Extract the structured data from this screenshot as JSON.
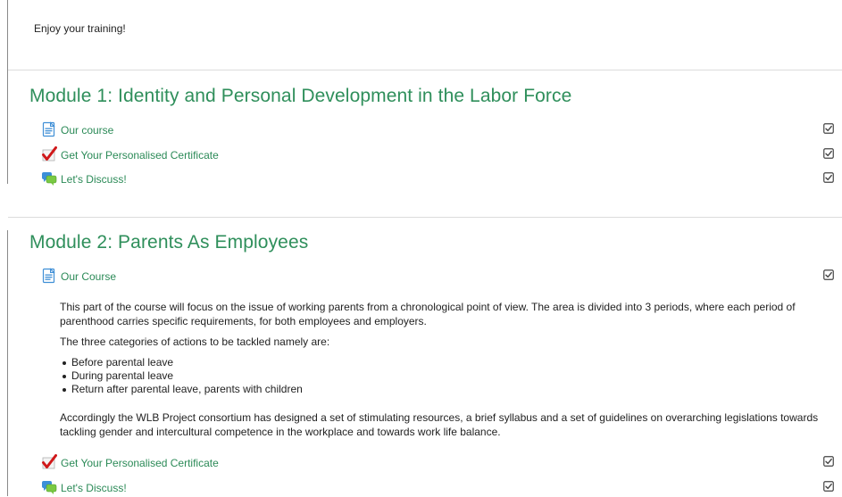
{
  "intro_text": "Enjoy your training!",
  "sections": [
    {
      "title": "Module 1: Identity and Personal Development in the Labor Force",
      "activities": [
        {
          "label": "Our course",
          "icon": "page-icon",
          "completed": true
        },
        {
          "label": "Get Your Personalised Certificate",
          "icon": "certificate-icon",
          "completed": true
        },
        {
          "label": "Let's Discuss!",
          "icon": "forum-icon",
          "completed": true
        }
      ]
    },
    {
      "title": "Module 2: Parents As Employees",
      "activities": [
        {
          "label": "Our Course",
          "icon": "page-icon",
          "completed": true
        },
        {
          "label": "Get Your Personalised Certificate",
          "icon": "certificate-icon",
          "completed": true
        },
        {
          "label": "Let's Discuss!",
          "icon": "forum-icon",
          "completed": true
        }
      ],
      "description": {
        "paragraph1": "This part of the course will focus on the issue of working parents from a chronological point of view. The area is divided into 3 periods, where each period of parenthood carries specific requirements, for both employees and employers.",
        "paragraph2": "The three categories of actions to be tackled namely are:",
        "bullets": [
          "Before parental leave",
          "During parental leave",
          "Return after parental leave, parents with children"
        ],
        "paragraph3": "Accordingly the WLB Project consortium has designed a set of stimulating resources, a brief syllabus and a set of guidelines on overarching legislations towards tackling gender and intercultural competence in the workplace and towards work life balance."
      }
    }
  ],
  "colors": {
    "link": "#2b8a57",
    "section_title": "#2f8f5b",
    "divider": "#dcdcdc"
  }
}
